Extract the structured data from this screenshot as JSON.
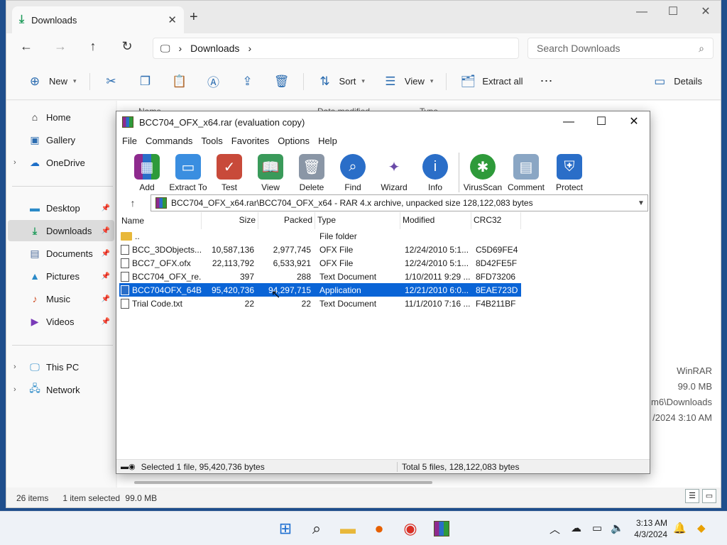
{
  "explorer": {
    "tab_title": "Downloads",
    "breadcrumb": "Downloads",
    "search_placeholder": "Search Downloads",
    "toolbar": {
      "new": "New",
      "sort": "Sort",
      "view": "View",
      "extract_all": "Extract all",
      "more": "⋯",
      "details": "Details"
    },
    "hidden_headers": {
      "name": "Name",
      "date_modified": "Date modified",
      "type": "Type"
    },
    "sidebar": {
      "home": "Home",
      "gallery": "Gallery",
      "onedrive": "OneDrive",
      "desktop": "Desktop",
      "downloads": "Downloads",
      "documents": "Documents",
      "pictures": "Pictures",
      "music": "Music",
      "videos": "Videos",
      "this_pc": "This PC",
      "network": "Network"
    },
    "details_pane": {
      "app": "WinRAR",
      "size": "99.0 MB",
      "path": "m6\\Downloads",
      "date": "/2024 3:10 AM"
    },
    "status": {
      "items": "26 items",
      "selected": "1 item selected",
      "size": "99.0 MB"
    }
  },
  "winrar": {
    "title": "BCC704_OFX_x64.rar (evaluation copy)",
    "menu": [
      "File",
      "Commands",
      "Tools",
      "Favorites",
      "Options",
      "Help"
    ],
    "tools": [
      "Add",
      "Extract To",
      "Test",
      "View",
      "Delete",
      "Find",
      "Wizard",
      "Info",
      "VirusScan",
      "Comment",
      "Protect"
    ],
    "path": "BCC704_OFX_x64.rar\\BCC704_OFX_x64 - RAR 4.x archive, unpacked size 128,122,083 bytes",
    "columns": {
      "name": "Name",
      "size": "Size",
      "packed": "Packed",
      "type": "Type",
      "modified": "Modified",
      "crc": "CRC32"
    },
    "rows": [
      {
        "name": "..",
        "size": "",
        "packed": "",
        "type": "File folder",
        "modified": "",
        "crc": ""
      },
      {
        "name": "BCC_3DObjects....",
        "size": "10,587,136",
        "packed": "2,977,745",
        "type": "OFX File",
        "modified": "12/24/2010 5:1...",
        "crc": "C5D69FE4"
      },
      {
        "name": "BCC7_OFX.ofx",
        "size": "22,113,792",
        "packed": "6,533,921",
        "type": "OFX File",
        "modified": "12/24/2010 5:1...",
        "crc": "8D42FE5F"
      },
      {
        "name": "BCC704_OFX_re...",
        "size": "397",
        "packed": "288",
        "type": "Text Document",
        "modified": "1/10/2011 9:29 ...",
        "crc": "8FD73206"
      },
      {
        "name": "BCC704OFX_64B...",
        "size": "95,420,736",
        "packed": "94,297,715",
        "type": "Application",
        "modified": "12/21/2010 6:0...",
        "crc": "8EAE723D"
      },
      {
        "name": "Trial Code.txt",
        "size": "22",
        "packed": "22",
        "type": "Text Document",
        "modified": "11/1/2010 7:16 ...",
        "crc": "F4B211BF"
      }
    ],
    "status_left": "Selected 1 file, 95,420,736 bytes",
    "status_right": "Total 5 files, 128,122,083 bytes"
  },
  "taskbar": {
    "time": "3:13 AM",
    "date": "4/3/2024"
  }
}
